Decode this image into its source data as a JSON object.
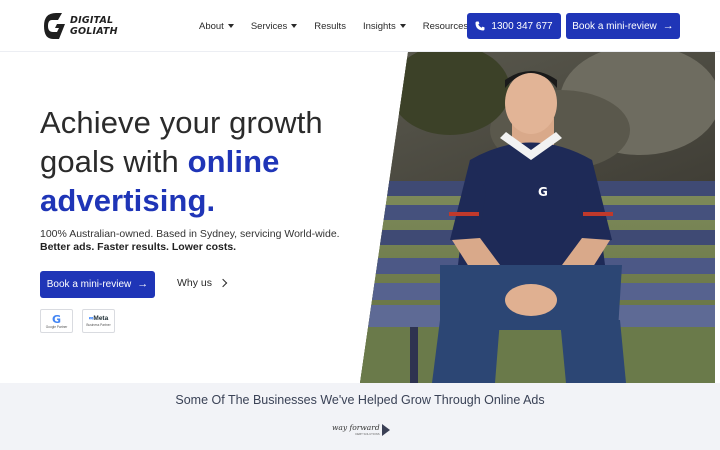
{
  "header": {
    "logo": {
      "line1": "DIGITAL",
      "line2": "GOLIATH"
    },
    "nav": [
      {
        "label": "About",
        "has_dropdown": true
      },
      {
        "label": "Services",
        "has_dropdown": true
      },
      {
        "label": "Results",
        "has_dropdown": false
      },
      {
        "label": "Insights",
        "has_dropdown": true
      },
      {
        "label": "Resources",
        "has_dropdown": true
      }
    ],
    "phone_button": {
      "label": "1300 347 677",
      "icon": "phone-icon"
    },
    "cta_button": {
      "label": "Book a mini-review",
      "icon": "arrow-right-icon"
    }
  },
  "hero": {
    "title_part1": "Achieve your growth goals with ",
    "title_accent": "online advertising.",
    "subtitle": "100% Australian-owned. Based in Sydney, servicing World-wide.",
    "bold_line": "Better ads. Faster results. Lower costs.",
    "primary_button": {
      "label": "Book a mini-review",
      "icon": "arrow-right-icon"
    },
    "secondary_link": {
      "label": "Why us",
      "icon": "chevron-right-icon"
    },
    "badges": [
      {
        "mark": "G",
        "caption": "Google Partner"
      },
      {
        "mark": "Meta",
        "caption": "Business Partner"
      }
    ]
  },
  "clients": {
    "title": "Some Of The Businesses We've Helped Grow Through Online Ads",
    "logo": {
      "name": "way forward",
      "caption": "DEBT SOLUTIONS"
    }
  },
  "colors": {
    "accent": "#1f35b7",
    "text": "#2b2b2b",
    "band_bg": "#f2f3f7"
  }
}
